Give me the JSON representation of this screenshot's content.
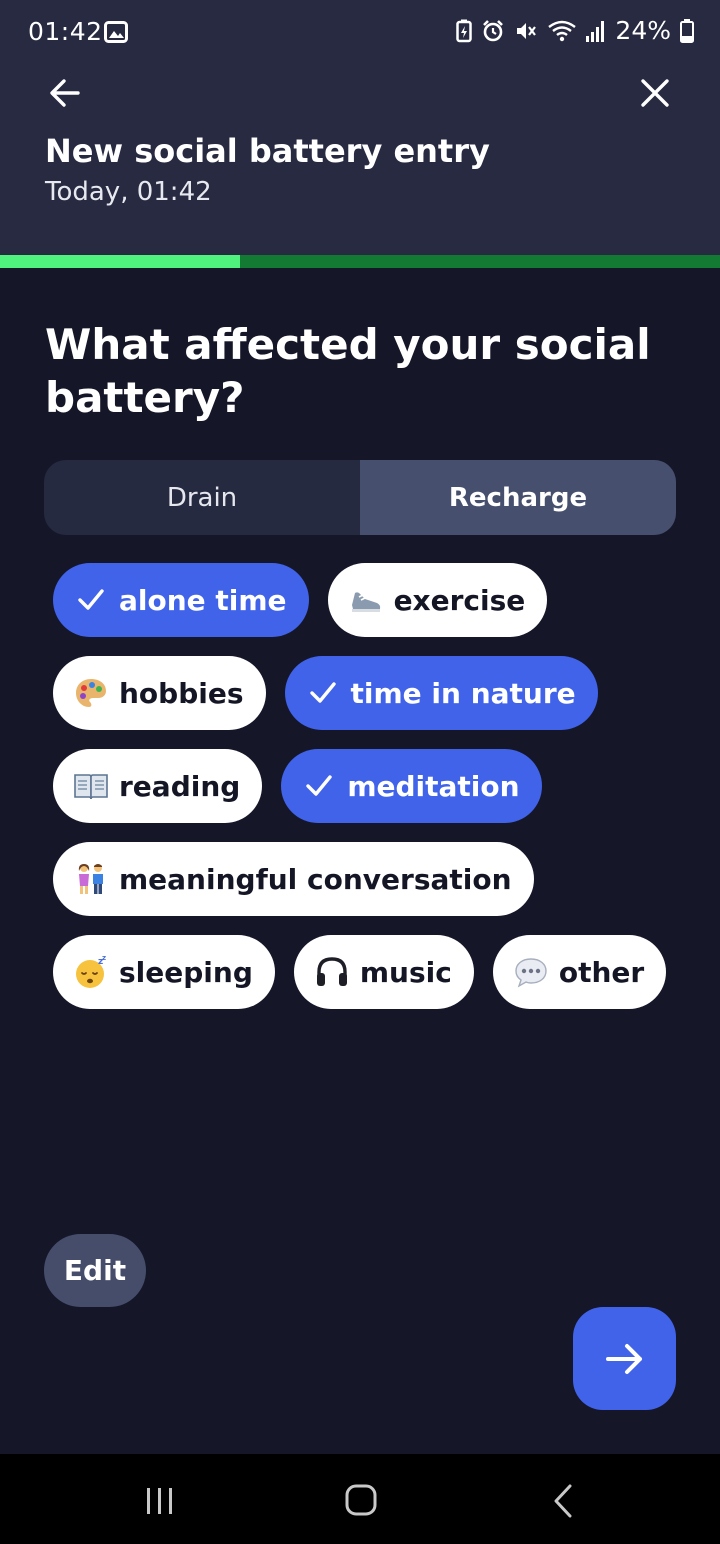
{
  "status_bar": {
    "time": "01:42",
    "battery_text": "24%",
    "icons": [
      "image-icon",
      "battery-saver-icon",
      "alarm-icon",
      "mute-icon",
      "wifi-icon",
      "signal-icon",
      "battery-icon"
    ]
  },
  "header": {
    "title": "New social battery entry",
    "subtitle": "Today, 01:42",
    "back_icon": "arrow-left-icon",
    "close_icon": "close-icon"
  },
  "progress": {
    "fraction": 0.333
  },
  "question": "What affected your social battery?",
  "segmented": {
    "options": [
      "Drain",
      "Recharge"
    ],
    "selected": "Recharge"
  },
  "chips": [
    {
      "label": "alone time",
      "icon": "check-icon",
      "selected": true
    },
    {
      "label": "exercise",
      "icon": "sneaker-icon",
      "selected": false
    },
    {
      "label": "hobbies",
      "icon": "palette-icon",
      "selected": false
    },
    {
      "label": "time in nature",
      "icon": "check-icon",
      "selected": true
    },
    {
      "label": "reading",
      "icon": "book-icon",
      "selected": false
    },
    {
      "label": "meditation",
      "icon": "check-icon",
      "selected": true
    },
    {
      "label": "meaningful conversation",
      "icon": "people-icon",
      "selected": false
    },
    {
      "label": "sleeping",
      "icon": "sleeping-face-icon",
      "selected": false
    },
    {
      "label": "music",
      "icon": "headphones-icon",
      "selected": false
    },
    {
      "label": "other",
      "icon": "speech-bubble-icon",
      "selected": false
    }
  ],
  "edit_label": "Edit",
  "next_icon": "arrow-right-icon",
  "colors": {
    "accent": "#4063ea",
    "progress_fill": "#4ff27d",
    "progress_track": "#137a34",
    "background": "#151729",
    "header": "#272a40"
  }
}
